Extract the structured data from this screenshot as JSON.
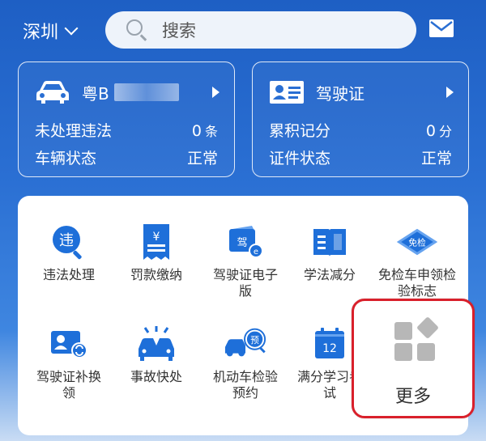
{
  "topbar": {
    "city": "深圳",
    "search_placeholder": "搜索",
    "icons": [
      "chevron-down-icon",
      "search-icon",
      "mail-icon"
    ]
  },
  "vehicle_card": {
    "plate": "粤B",
    "icon": "car-icon",
    "rows": [
      {
        "label": "未处理违法",
        "value": "0",
        "unit": "条"
      },
      {
        "label": "车辆状态",
        "value": "正常",
        "unit": ""
      }
    ]
  },
  "license_card": {
    "title": "驾驶证",
    "icon": "id-card-icon",
    "rows": [
      {
        "label": "累积记分",
        "value": "0",
        "unit": "分"
      },
      {
        "label": "证件状态",
        "value": "正常",
        "unit": ""
      }
    ]
  },
  "services": [
    {
      "label": "违法处理",
      "icon": "violation-search-icon"
    },
    {
      "label": "罚款缴纳",
      "icon": "receipt-yen-icon"
    },
    {
      "label": "驾驶证电子版",
      "icon": "e-license-icon"
    },
    {
      "label": "学法减分",
      "icon": "book-icon"
    },
    {
      "label": "免检车申领检验标志",
      "icon": "exempt-badge-icon"
    },
    {
      "label": "驾驶证补换领",
      "icon": "license-renew-icon"
    },
    {
      "label": "事故快处",
      "icon": "accident-icon"
    },
    {
      "label": "机动车检验预约",
      "icon": "inspection-booking-icon"
    },
    {
      "label": "满分学习考试",
      "icon": "calendar-exam-icon"
    }
  ],
  "more": {
    "label": "更多",
    "icon": "more-apps-icon"
  },
  "colors": {
    "brand_blue": "#2a6fd3",
    "icon_blue": "#1e6fd9",
    "highlight_red": "#d9202b"
  }
}
